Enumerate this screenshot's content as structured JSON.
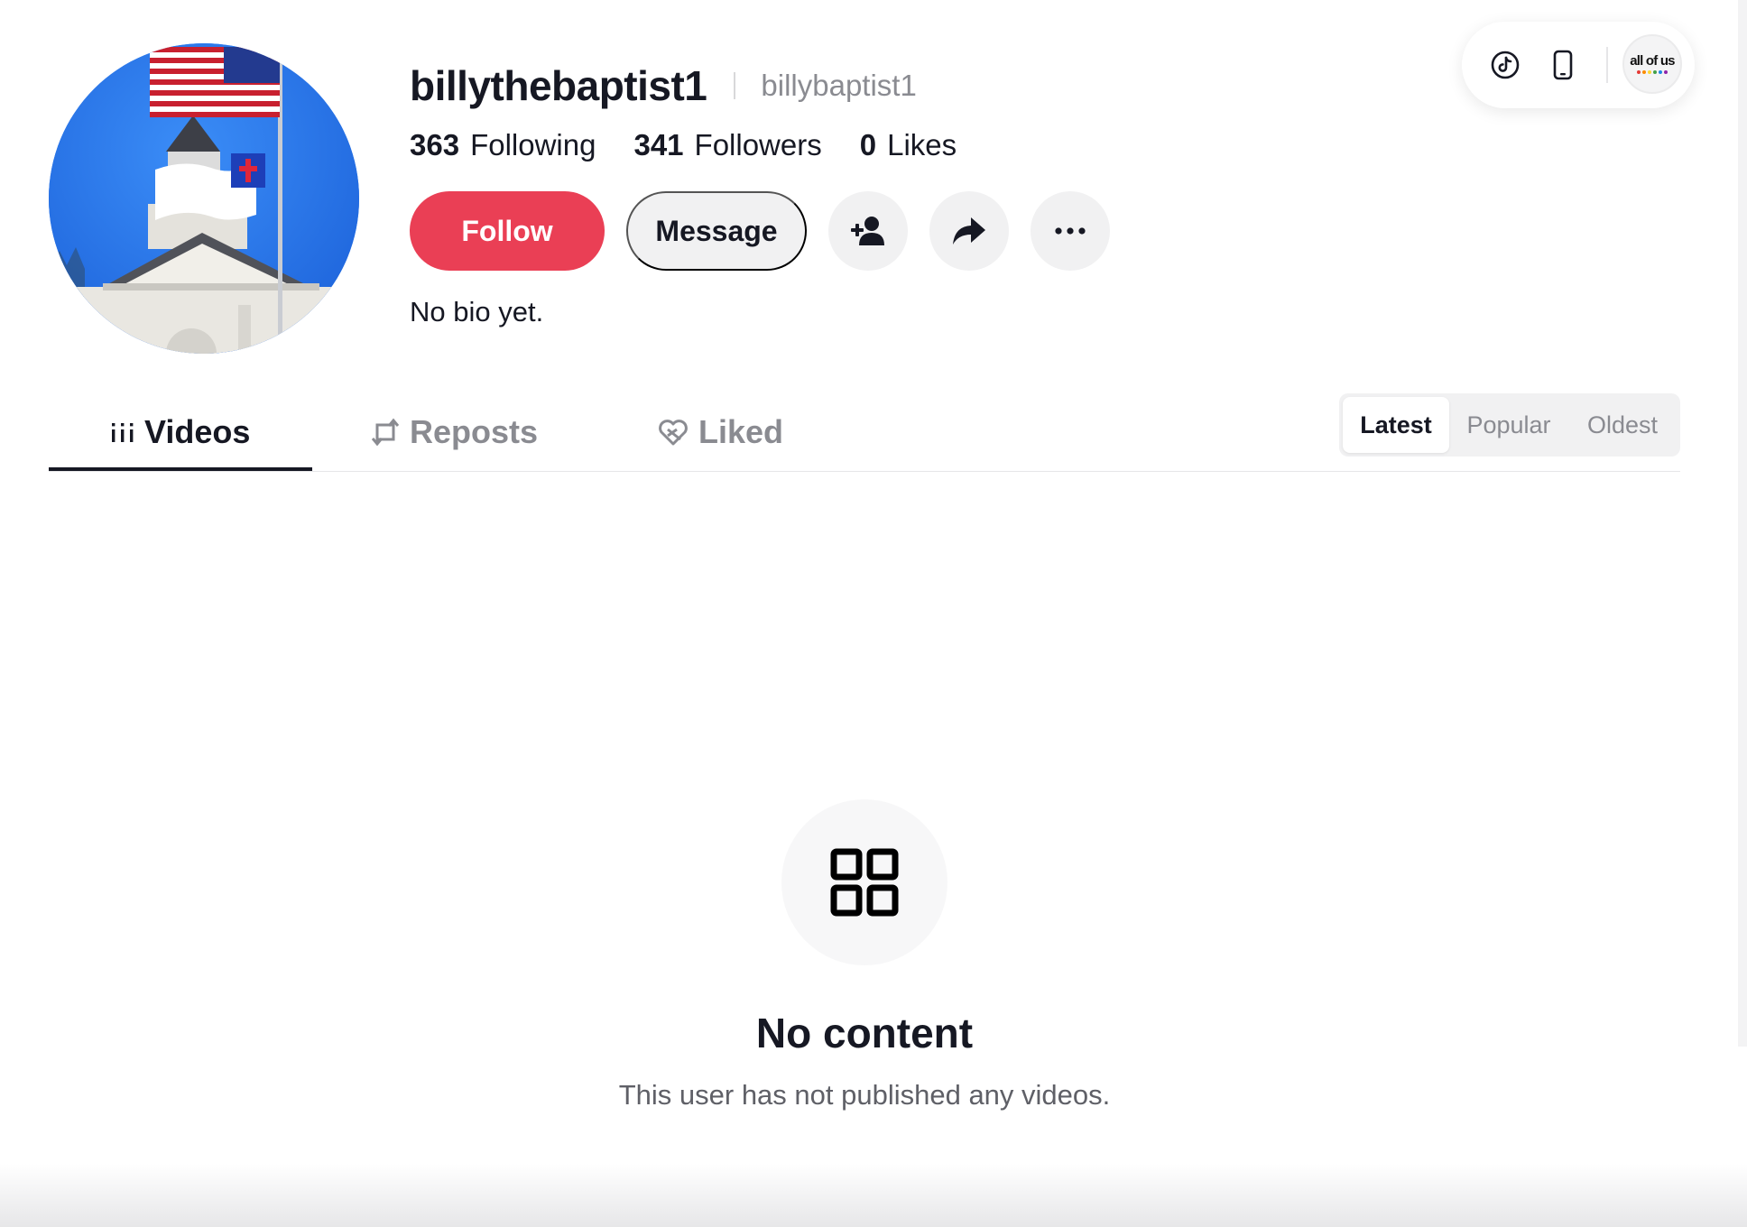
{
  "profile": {
    "username": "billythebaptist1",
    "nickname": "billybaptist1",
    "bio": "No bio yet.",
    "stats": [
      {
        "value": "363",
        "label": "Following"
      },
      {
        "value": "341",
        "label": "Followers"
      },
      {
        "value": "0",
        "label": "Likes"
      }
    ]
  },
  "actions": {
    "follow_label": "Follow",
    "message_label": "Message",
    "icons": [
      "add-friend-icon",
      "share-icon",
      "more-icon"
    ]
  },
  "top_pill": {
    "icons": [
      "tiktok-icon",
      "phone-icon"
    ],
    "logo_text": "all of us"
  },
  "tabs": [
    {
      "label": "Videos",
      "icon": "grid-lines-icon",
      "active": true
    },
    {
      "label": "Reposts",
      "icon": "repost-icon",
      "active": false
    },
    {
      "label": "Liked",
      "icon": "liked-heart-icon",
      "active": false
    }
  ],
  "sort": {
    "options": [
      "Latest",
      "Popular",
      "Oldest"
    ],
    "selected": "Latest"
  },
  "empty_state": {
    "icon": "grid-icon",
    "title": "No content",
    "subtitle": "This user has not published any videos."
  },
  "colors": {
    "accent": "#ea3f55",
    "text_primary": "#161823",
    "text_secondary": "#8a8b91",
    "button_bg": "#f1f1f2"
  }
}
